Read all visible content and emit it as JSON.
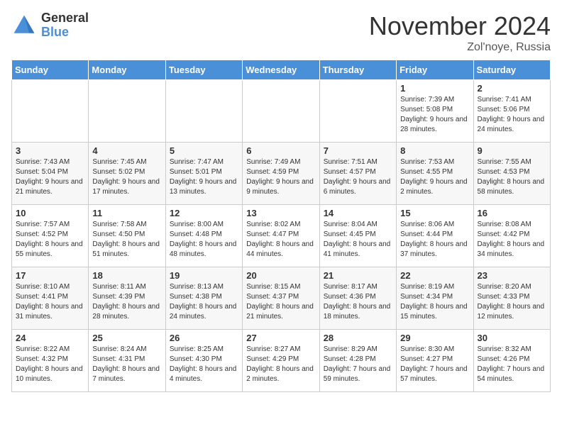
{
  "header": {
    "logo_general": "General",
    "logo_blue": "Blue",
    "month_title": "November 2024",
    "location": "Zol'noye, Russia"
  },
  "weekdays": [
    "Sunday",
    "Monday",
    "Tuesday",
    "Wednesday",
    "Thursday",
    "Friday",
    "Saturday"
  ],
  "weeks": [
    [
      {
        "day": "",
        "sunrise": "",
        "sunset": "",
        "daylight": ""
      },
      {
        "day": "",
        "sunrise": "",
        "sunset": "",
        "daylight": ""
      },
      {
        "day": "",
        "sunrise": "",
        "sunset": "",
        "daylight": ""
      },
      {
        "day": "",
        "sunrise": "",
        "sunset": "",
        "daylight": ""
      },
      {
        "day": "",
        "sunrise": "",
        "sunset": "",
        "daylight": ""
      },
      {
        "day": "1",
        "sunrise": "Sunrise: 7:39 AM",
        "sunset": "Sunset: 5:08 PM",
        "daylight": "Daylight: 9 hours and 28 minutes."
      },
      {
        "day": "2",
        "sunrise": "Sunrise: 7:41 AM",
        "sunset": "Sunset: 5:06 PM",
        "daylight": "Daylight: 9 hours and 24 minutes."
      }
    ],
    [
      {
        "day": "3",
        "sunrise": "Sunrise: 7:43 AM",
        "sunset": "Sunset: 5:04 PM",
        "daylight": "Daylight: 9 hours and 21 minutes."
      },
      {
        "day": "4",
        "sunrise": "Sunrise: 7:45 AM",
        "sunset": "Sunset: 5:02 PM",
        "daylight": "Daylight: 9 hours and 17 minutes."
      },
      {
        "day": "5",
        "sunrise": "Sunrise: 7:47 AM",
        "sunset": "Sunset: 5:01 PM",
        "daylight": "Daylight: 9 hours and 13 minutes."
      },
      {
        "day": "6",
        "sunrise": "Sunrise: 7:49 AM",
        "sunset": "Sunset: 4:59 PM",
        "daylight": "Daylight: 9 hours and 9 minutes."
      },
      {
        "day": "7",
        "sunrise": "Sunrise: 7:51 AM",
        "sunset": "Sunset: 4:57 PM",
        "daylight": "Daylight: 9 hours and 6 minutes."
      },
      {
        "day": "8",
        "sunrise": "Sunrise: 7:53 AM",
        "sunset": "Sunset: 4:55 PM",
        "daylight": "Daylight: 9 hours and 2 minutes."
      },
      {
        "day": "9",
        "sunrise": "Sunrise: 7:55 AM",
        "sunset": "Sunset: 4:53 PM",
        "daylight": "Daylight: 8 hours and 58 minutes."
      }
    ],
    [
      {
        "day": "10",
        "sunrise": "Sunrise: 7:57 AM",
        "sunset": "Sunset: 4:52 PM",
        "daylight": "Daylight: 8 hours and 55 minutes."
      },
      {
        "day": "11",
        "sunrise": "Sunrise: 7:58 AM",
        "sunset": "Sunset: 4:50 PM",
        "daylight": "Daylight: 8 hours and 51 minutes."
      },
      {
        "day": "12",
        "sunrise": "Sunrise: 8:00 AM",
        "sunset": "Sunset: 4:48 PM",
        "daylight": "Daylight: 8 hours and 48 minutes."
      },
      {
        "day": "13",
        "sunrise": "Sunrise: 8:02 AM",
        "sunset": "Sunset: 4:47 PM",
        "daylight": "Daylight: 8 hours and 44 minutes."
      },
      {
        "day": "14",
        "sunrise": "Sunrise: 8:04 AM",
        "sunset": "Sunset: 4:45 PM",
        "daylight": "Daylight: 8 hours and 41 minutes."
      },
      {
        "day": "15",
        "sunrise": "Sunrise: 8:06 AM",
        "sunset": "Sunset: 4:44 PM",
        "daylight": "Daylight: 8 hours and 37 minutes."
      },
      {
        "day": "16",
        "sunrise": "Sunrise: 8:08 AM",
        "sunset": "Sunset: 4:42 PM",
        "daylight": "Daylight: 8 hours and 34 minutes."
      }
    ],
    [
      {
        "day": "17",
        "sunrise": "Sunrise: 8:10 AM",
        "sunset": "Sunset: 4:41 PM",
        "daylight": "Daylight: 8 hours and 31 minutes."
      },
      {
        "day": "18",
        "sunrise": "Sunrise: 8:11 AM",
        "sunset": "Sunset: 4:39 PM",
        "daylight": "Daylight: 8 hours and 28 minutes."
      },
      {
        "day": "19",
        "sunrise": "Sunrise: 8:13 AM",
        "sunset": "Sunset: 4:38 PM",
        "daylight": "Daylight: 8 hours and 24 minutes."
      },
      {
        "day": "20",
        "sunrise": "Sunrise: 8:15 AM",
        "sunset": "Sunset: 4:37 PM",
        "daylight": "Daylight: 8 hours and 21 minutes."
      },
      {
        "day": "21",
        "sunrise": "Sunrise: 8:17 AM",
        "sunset": "Sunset: 4:36 PM",
        "daylight": "Daylight: 8 hours and 18 minutes."
      },
      {
        "day": "22",
        "sunrise": "Sunrise: 8:19 AM",
        "sunset": "Sunset: 4:34 PM",
        "daylight": "Daylight: 8 hours and 15 minutes."
      },
      {
        "day": "23",
        "sunrise": "Sunrise: 8:20 AM",
        "sunset": "Sunset: 4:33 PM",
        "daylight": "Daylight: 8 hours and 12 minutes."
      }
    ],
    [
      {
        "day": "24",
        "sunrise": "Sunrise: 8:22 AM",
        "sunset": "Sunset: 4:32 PM",
        "daylight": "Daylight: 8 hours and 10 minutes."
      },
      {
        "day": "25",
        "sunrise": "Sunrise: 8:24 AM",
        "sunset": "Sunset: 4:31 PM",
        "daylight": "Daylight: 8 hours and 7 minutes."
      },
      {
        "day": "26",
        "sunrise": "Sunrise: 8:25 AM",
        "sunset": "Sunset: 4:30 PM",
        "daylight": "Daylight: 8 hours and 4 minutes."
      },
      {
        "day": "27",
        "sunrise": "Sunrise: 8:27 AM",
        "sunset": "Sunset: 4:29 PM",
        "daylight": "Daylight: 8 hours and 2 minutes."
      },
      {
        "day": "28",
        "sunrise": "Sunrise: 8:29 AM",
        "sunset": "Sunset: 4:28 PM",
        "daylight": "Daylight: 7 hours and 59 minutes."
      },
      {
        "day": "29",
        "sunrise": "Sunrise: 8:30 AM",
        "sunset": "Sunset: 4:27 PM",
        "daylight": "Daylight: 7 hours and 57 minutes."
      },
      {
        "day": "30",
        "sunrise": "Sunrise: 8:32 AM",
        "sunset": "Sunset: 4:26 PM",
        "daylight": "Daylight: 7 hours and 54 minutes."
      }
    ]
  ]
}
